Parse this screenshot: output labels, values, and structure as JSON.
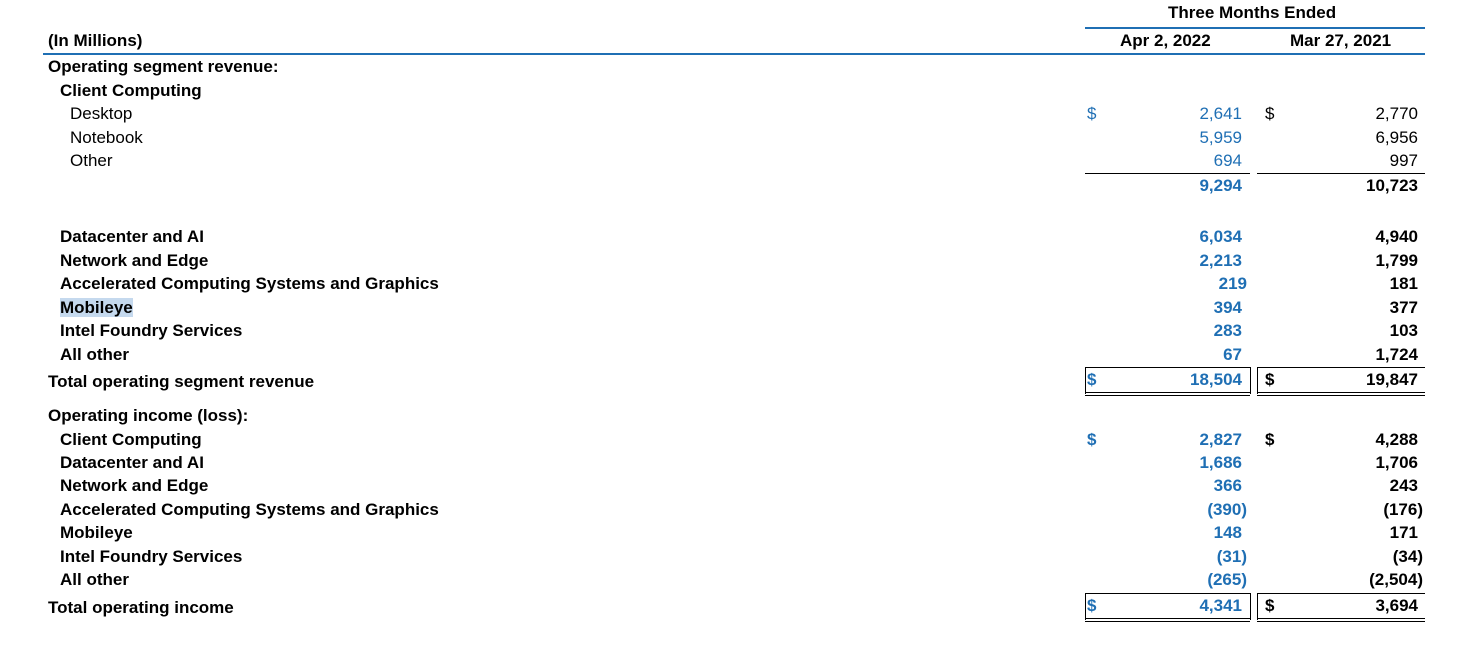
{
  "table": {
    "units_label": "(In Millions)",
    "period_header": "Three Months Ended",
    "col1_header": "Apr 2, 2022",
    "col2_header": "Mar 27, 2021",
    "currency_symbol": "$",
    "revenue_section_title": "Operating segment revenue:",
    "client_computing_title": "Client Computing",
    "client_rows": [
      {
        "label": "Desktop",
        "v1": "2,641",
        "v2": "2,770"
      },
      {
        "label": "Notebook",
        "v1": "5,959",
        "v2": "6,956"
      },
      {
        "label": "Other",
        "v1": "694",
        "v2": "997"
      }
    ],
    "client_subtotal": {
      "v1": "9,294",
      "v2": "10,723"
    },
    "segment_rows": [
      {
        "label": "Datacenter and AI",
        "v1": "6,034",
        "v2": "4,940"
      },
      {
        "label": "Network and Edge",
        "v1": "2,213",
        "v2": "1,799"
      },
      {
        "label": "Accelerated Computing Systems and Graphics",
        "v1": "219",
        "v2": "181"
      },
      {
        "label": "Mobileye",
        "v1": "394",
        "v2": "377"
      },
      {
        "label": "Intel Foundry Services",
        "v1": "283",
        "v2": "103"
      },
      {
        "label": "All other",
        "v1": "67",
        "v2": "1,724"
      }
    ],
    "total_revenue": {
      "label": "Total operating segment revenue",
      "v1": "18,504",
      "v2": "19,847"
    },
    "income_section_title": "Operating income (loss):",
    "income_rows": [
      {
        "label": "Client Computing",
        "v1": "2,827",
        "v2": "4,288"
      },
      {
        "label": "Datacenter and AI",
        "v1": "1,686",
        "v2": "1,706"
      },
      {
        "label": "Network and Edge",
        "v1": "366",
        "v2": "243"
      },
      {
        "label": "Accelerated Computing Systems and Graphics",
        "v1": "(390)",
        "v2": "(176)"
      },
      {
        "label": "Mobileye",
        "v1": "148",
        "v2": "171"
      },
      {
        "label": "Intel Foundry Services",
        "v1": "(31)",
        "v2": "(34)"
      },
      {
        "label": "All other",
        "v1": "(265)",
        "v2": "(2,504)"
      }
    ],
    "total_income": {
      "label": "Total operating income",
      "v1": "4,341",
      "v2": "3,694"
    }
  }
}
